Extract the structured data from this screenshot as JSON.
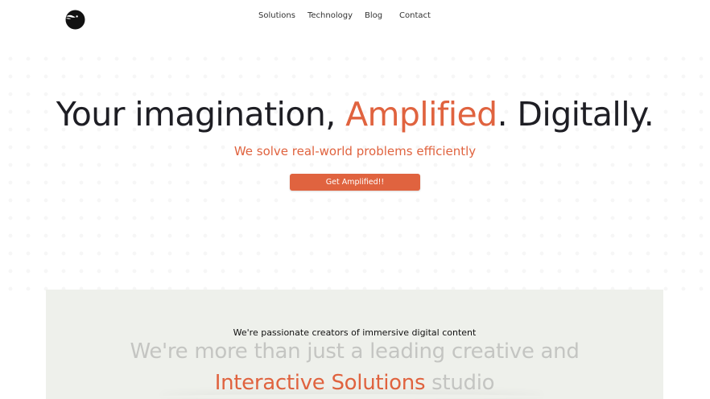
{
  "nav": {
    "logo_icon": "bird-head-logo-icon",
    "links": [
      {
        "label": "Solutions"
      },
      {
        "label": "Technology"
      },
      {
        "label": "Blog"
      },
      {
        "label": "Contact"
      }
    ]
  },
  "hero": {
    "title_pre": "Your imagination, ",
    "title_accent": "Amplified",
    "title_post": ". Digitally.",
    "subtitle": "We solve real-world problems efficiently",
    "cta_label": "Get Amplified!!"
  },
  "about": {
    "eyebrow": "We're passionate creators of immersive digital content",
    "line1": "We're more than just a leading creative and",
    "line2_accent": "Interactive Solutions",
    "line2_post": " studio"
  },
  "colors": {
    "accent": "#e0633f",
    "text_dark": "#1e1e24",
    "muted_text": "#c4c5c2",
    "panel_bg": "#eef0eb"
  }
}
